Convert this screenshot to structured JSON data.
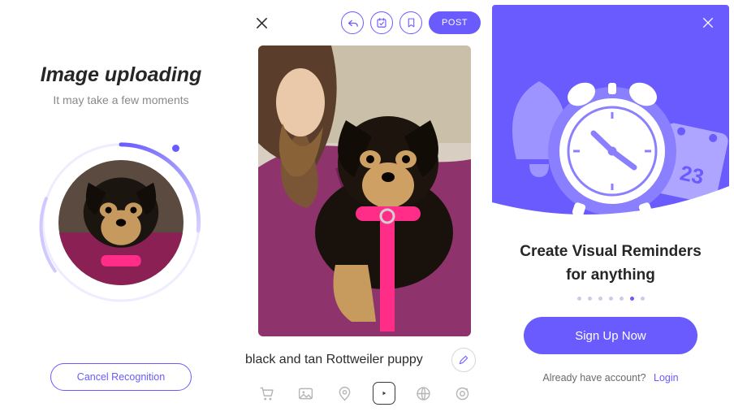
{
  "colors": {
    "accent": "#6a5bff"
  },
  "panelA": {
    "title": "Image uploading",
    "subtitle": "It may take a few moments",
    "cancel_label": "Cancel Recognition"
  },
  "panelB": {
    "post_label": "POST",
    "caption": "black and tan Rottweiler puppy",
    "actions": {
      "reply": "reply-icon",
      "calendar": "calendar-check-icon",
      "bookmark": "bookmark-icon"
    },
    "tools": [
      "cart",
      "image",
      "location",
      "video",
      "globe",
      "target"
    ],
    "active_tool_index": 3
  },
  "panelC": {
    "title": "Create Visual Reminders for anything",
    "page_count": 7,
    "active_page_index": 5,
    "cta_label": "Sign Up Now",
    "login_prompt": "Already have account?",
    "login_link": "Login",
    "calendar_day": "23"
  }
}
